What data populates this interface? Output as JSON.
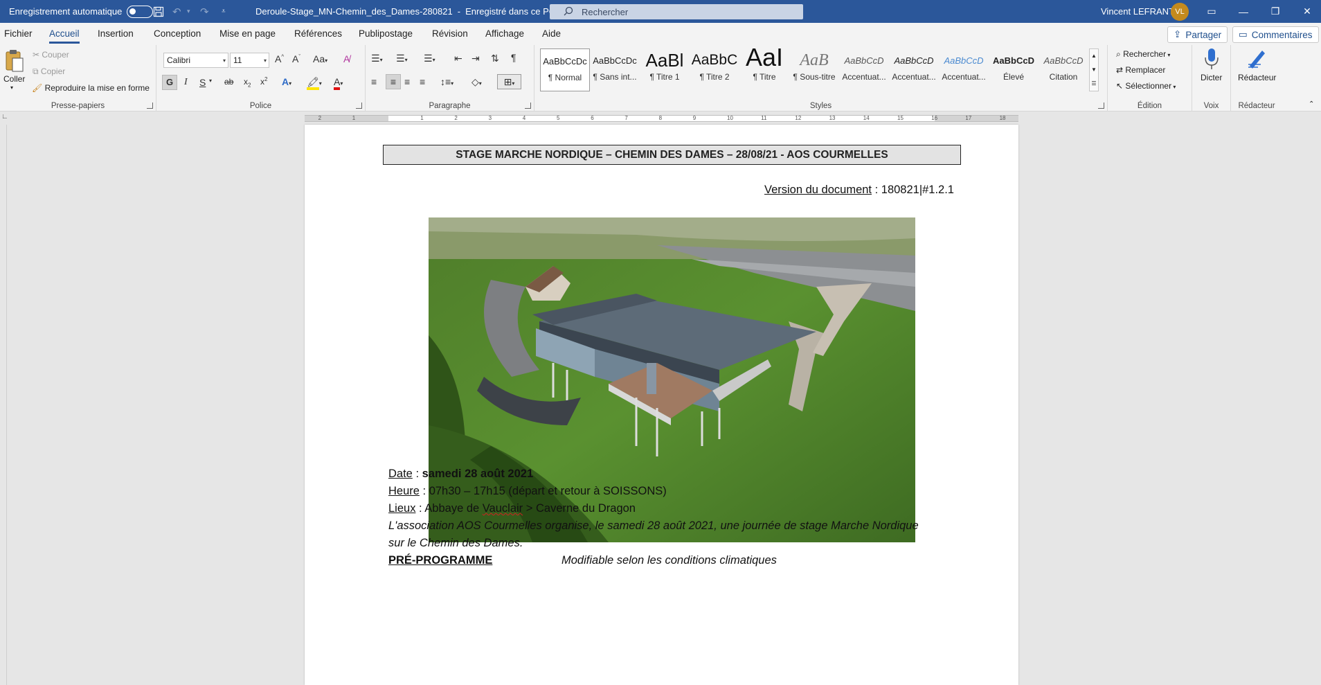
{
  "titlebar": {
    "autosave_label": "Enregistrement automatique",
    "doc_title": "Deroule-Stage_MN-Chemin_des_Dames-280821",
    "save_status": "Enregistré dans ce PC",
    "search_placeholder": "Rechercher",
    "user_name": "Vincent LEFRANT",
    "user_initials": "VL",
    "bg_color": "#2b579a"
  },
  "menu": {
    "tabs": [
      "Fichier",
      "Accueil",
      "Insertion",
      "Conception",
      "Mise en page",
      "Références",
      "Publipostage",
      "Révision",
      "Affichage",
      "Aide"
    ],
    "active_tab": "Accueil",
    "share_label": "Partager",
    "comments_label": "Commentaires"
  },
  "ribbon": {
    "clipboard": {
      "paste": "Coller",
      "cut": "Couper",
      "copy": "Copier",
      "format_painter": "Reproduire la mise en forme",
      "group": "Presse-papiers"
    },
    "font": {
      "name": "Calibri",
      "size": "11",
      "group": "Police",
      "bold": "G",
      "italic": "I",
      "underline": "S"
    },
    "paragraph": {
      "group": "Paragraphe"
    },
    "styles": {
      "group": "Styles",
      "items": [
        {
          "preview": "AaBbCcDc",
          "name": "¶ Normal"
        },
        {
          "preview": "AaBbCcDc",
          "name": "¶ Sans int..."
        },
        {
          "preview": "AaBl",
          "name": "¶ Titre 1"
        },
        {
          "preview": "AaBbC",
          "name": "¶ Titre 2"
        },
        {
          "preview": "AaI",
          "name": "¶ Titre"
        },
        {
          "preview": "AaB",
          "name": "¶ Sous-titre"
        },
        {
          "preview": "AaBbCcD",
          "name": "Accentuat..."
        },
        {
          "preview": "AaBbCcD",
          "name": "Accentuat..."
        },
        {
          "preview": "AaBbCcD",
          "name": "Accentuat..."
        },
        {
          "preview": "AaBbCcD",
          "name": "Élevé"
        },
        {
          "preview": "AaBbCcD",
          "name": "Citation"
        }
      ]
    },
    "editing": {
      "find": "Rechercher",
      "replace": "Remplacer",
      "select": "Sélectionner",
      "group": "Édition"
    },
    "voice": {
      "dictate": "Dicter",
      "group": "Voix"
    },
    "editor": {
      "label": "Rédacteur",
      "group": "Rédacteur"
    }
  },
  "ruler": {
    "ticks": [
      "2",
      "1",
      "1",
      "2",
      "3",
      "4",
      "5",
      "6",
      "7",
      "8",
      "9",
      "10",
      "11",
      "12",
      "13",
      "14",
      "15",
      "16",
      "17",
      "18"
    ]
  },
  "document": {
    "heading": "STAGE MARCHE NORDIQUE – CHEMIN DES DAMES – 28/08/21 - AOS COURMELLES",
    "version_label": "Version du document",
    "version_value": " : 180821|#1.2.1",
    "date_label": "Date",
    "date_value": "samedi 28 août 2021",
    "time_label": "Heure",
    "time_value": " : 07h30 – 17h15 (départ et retour à SOISSONS)",
    "place_label": "Lieux",
    "place_value_1": " : Abbaye de ",
    "place_vauclair": "Vauclair",
    "place_value_2": " > Caverne du Dragon",
    "intro_line1": "L'association AOS Courmelles organise, le samedi 28 août 2021, une journée de stage Marche Nordique",
    "intro_line2": "sur le Chemin des Dames.",
    "program_label": "PRÉ-PROGRAMME",
    "program_note": "Modifiable selon les conditions climatiques"
  }
}
